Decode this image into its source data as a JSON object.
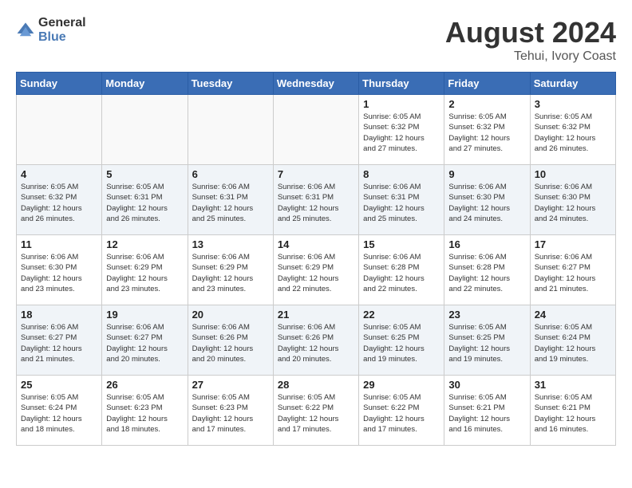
{
  "logo": {
    "general": "General",
    "blue": "Blue"
  },
  "title": {
    "month": "August 2024",
    "location": "Tehui, Ivory Coast"
  },
  "days_of_week": [
    "Sunday",
    "Monday",
    "Tuesday",
    "Wednesday",
    "Thursday",
    "Friday",
    "Saturday"
  ],
  "weeks": [
    [
      {
        "day": "",
        "info": ""
      },
      {
        "day": "",
        "info": ""
      },
      {
        "day": "",
        "info": ""
      },
      {
        "day": "",
        "info": ""
      },
      {
        "day": "1",
        "info": "Sunrise: 6:05 AM\nSunset: 6:32 PM\nDaylight: 12 hours\nand 27 minutes."
      },
      {
        "day": "2",
        "info": "Sunrise: 6:05 AM\nSunset: 6:32 PM\nDaylight: 12 hours\nand 27 minutes."
      },
      {
        "day": "3",
        "info": "Sunrise: 6:05 AM\nSunset: 6:32 PM\nDaylight: 12 hours\nand 26 minutes."
      }
    ],
    [
      {
        "day": "4",
        "info": "Sunrise: 6:05 AM\nSunset: 6:32 PM\nDaylight: 12 hours\nand 26 minutes."
      },
      {
        "day": "5",
        "info": "Sunrise: 6:05 AM\nSunset: 6:31 PM\nDaylight: 12 hours\nand 26 minutes."
      },
      {
        "day": "6",
        "info": "Sunrise: 6:06 AM\nSunset: 6:31 PM\nDaylight: 12 hours\nand 25 minutes."
      },
      {
        "day": "7",
        "info": "Sunrise: 6:06 AM\nSunset: 6:31 PM\nDaylight: 12 hours\nand 25 minutes."
      },
      {
        "day": "8",
        "info": "Sunrise: 6:06 AM\nSunset: 6:31 PM\nDaylight: 12 hours\nand 25 minutes."
      },
      {
        "day": "9",
        "info": "Sunrise: 6:06 AM\nSunset: 6:30 PM\nDaylight: 12 hours\nand 24 minutes."
      },
      {
        "day": "10",
        "info": "Sunrise: 6:06 AM\nSunset: 6:30 PM\nDaylight: 12 hours\nand 24 minutes."
      }
    ],
    [
      {
        "day": "11",
        "info": "Sunrise: 6:06 AM\nSunset: 6:30 PM\nDaylight: 12 hours\nand 23 minutes."
      },
      {
        "day": "12",
        "info": "Sunrise: 6:06 AM\nSunset: 6:29 PM\nDaylight: 12 hours\nand 23 minutes."
      },
      {
        "day": "13",
        "info": "Sunrise: 6:06 AM\nSunset: 6:29 PM\nDaylight: 12 hours\nand 23 minutes."
      },
      {
        "day": "14",
        "info": "Sunrise: 6:06 AM\nSunset: 6:29 PM\nDaylight: 12 hours\nand 22 minutes."
      },
      {
        "day": "15",
        "info": "Sunrise: 6:06 AM\nSunset: 6:28 PM\nDaylight: 12 hours\nand 22 minutes."
      },
      {
        "day": "16",
        "info": "Sunrise: 6:06 AM\nSunset: 6:28 PM\nDaylight: 12 hours\nand 22 minutes."
      },
      {
        "day": "17",
        "info": "Sunrise: 6:06 AM\nSunset: 6:27 PM\nDaylight: 12 hours\nand 21 minutes."
      }
    ],
    [
      {
        "day": "18",
        "info": "Sunrise: 6:06 AM\nSunset: 6:27 PM\nDaylight: 12 hours\nand 21 minutes."
      },
      {
        "day": "19",
        "info": "Sunrise: 6:06 AM\nSunset: 6:27 PM\nDaylight: 12 hours\nand 20 minutes."
      },
      {
        "day": "20",
        "info": "Sunrise: 6:06 AM\nSunset: 6:26 PM\nDaylight: 12 hours\nand 20 minutes."
      },
      {
        "day": "21",
        "info": "Sunrise: 6:06 AM\nSunset: 6:26 PM\nDaylight: 12 hours\nand 20 minutes."
      },
      {
        "day": "22",
        "info": "Sunrise: 6:05 AM\nSunset: 6:25 PM\nDaylight: 12 hours\nand 19 minutes."
      },
      {
        "day": "23",
        "info": "Sunrise: 6:05 AM\nSunset: 6:25 PM\nDaylight: 12 hours\nand 19 minutes."
      },
      {
        "day": "24",
        "info": "Sunrise: 6:05 AM\nSunset: 6:24 PM\nDaylight: 12 hours\nand 19 minutes."
      }
    ],
    [
      {
        "day": "25",
        "info": "Sunrise: 6:05 AM\nSunset: 6:24 PM\nDaylight: 12 hours\nand 18 minutes."
      },
      {
        "day": "26",
        "info": "Sunrise: 6:05 AM\nSunset: 6:23 PM\nDaylight: 12 hours\nand 18 minutes."
      },
      {
        "day": "27",
        "info": "Sunrise: 6:05 AM\nSunset: 6:23 PM\nDaylight: 12 hours\nand 17 minutes."
      },
      {
        "day": "28",
        "info": "Sunrise: 6:05 AM\nSunset: 6:22 PM\nDaylight: 12 hours\nand 17 minutes."
      },
      {
        "day": "29",
        "info": "Sunrise: 6:05 AM\nSunset: 6:22 PM\nDaylight: 12 hours\nand 17 minutes."
      },
      {
        "day": "30",
        "info": "Sunrise: 6:05 AM\nSunset: 6:21 PM\nDaylight: 12 hours\nand 16 minutes."
      },
      {
        "day": "31",
        "info": "Sunrise: 6:05 AM\nSunset: 6:21 PM\nDaylight: 12 hours\nand 16 minutes."
      }
    ]
  ]
}
